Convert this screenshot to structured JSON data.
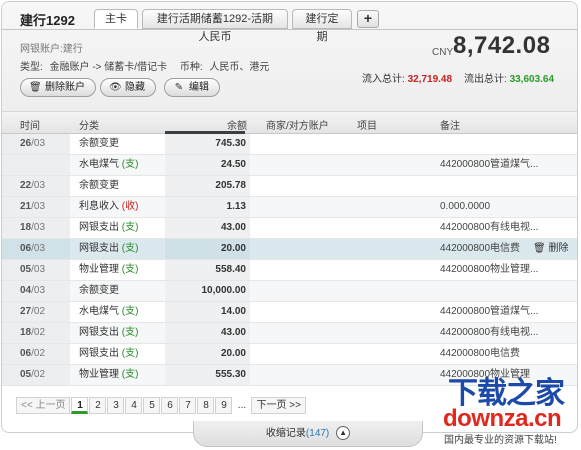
{
  "account": {
    "title": "建行1292",
    "tabs": [
      {
        "label": "主卡"
      },
      {
        "label": "建行活期储蓄1292-活期人民币"
      },
      {
        "label": "建行定期"
      }
    ],
    "add_tab_label": "+",
    "subtitle": "网银账户:建行",
    "type_label": "类型:",
    "type_value": "金融账户 -> 储蓄卡/借记卡",
    "currency_label": "币种:",
    "currency_value": "人民币、港元",
    "actions": {
      "delete": "删除账户",
      "hide": "隐藏",
      "edit": "编辑"
    },
    "balance_currency": "CNY",
    "balance": "8,742.08",
    "inflow_label": "流入总计:",
    "inflow": "32,719.48",
    "outflow_label": "流出总计:",
    "outflow": "33,603.64"
  },
  "colors": {
    "inflow": "#c62020",
    "outflow": "#2a9a2a",
    "selected_row": "#dbe9ef",
    "page_accent": "#2f9a2a"
  },
  "table": {
    "headers": {
      "time": "时间",
      "category": "分类",
      "amount": "余额",
      "merchant": "商家/对方账户",
      "project": "项目",
      "note": "备注"
    },
    "rows": [
      {
        "day": "26",
        "month": "/03",
        "cat": "余额变更",
        "tag": "",
        "tag_type": "",
        "amount": "745.30",
        "note": ""
      },
      {
        "day": "",
        "month": "",
        "cat": "水电煤气",
        "tag": "(支)",
        "tag_type": "out",
        "amount": "24.50",
        "note": "442000800管道煤气..."
      },
      {
        "day": "22",
        "month": "/03",
        "cat": "余额变更",
        "tag": "",
        "tag_type": "",
        "amount": "205.78",
        "note": ""
      },
      {
        "day": "21",
        "month": "/03",
        "cat": "利息收入",
        "tag": "(收)",
        "tag_type": "in",
        "amount": "1.13",
        "note": "0.000.0000"
      },
      {
        "day": "18",
        "month": "/03",
        "cat": "网银支出",
        "tag": "(支)",
        "tag_type": "out",
        "amount": "43.00",
        "note": "442000800有线电视..."
      },
      {
        "day": "06",
        "month": "/03",
        "cat": "网银支出",
        "tag": "(支)",
        "tag_type": "out",
        "amount": "20.00",
        "note": "442000800电信费",
        "selected": true,
        "delete": "删除"
      },
      {
        "day": "05",
        "month": "/03",
        "cat": "物业管理",
        "tag": "(支)",
        "tag_type": "out",
        "amount": "558.40",
        "note": "442000800物业管理..."
      },
      {
        "day": "04",
        "month": "/03",
        "cat": "余额变更",
        "tag": "",
        "tag_type": "",
        "amount": "10,000.00",
        "note": ""
      },
      {
        "day": "27",
        "month": "/02",
        "cat": "水电煤气",
        "tag": "(支)",
        "tag_type": "out",
        "amount": "14.00",
        "note": "442000800管道煤气..."
      },
      {
        "day": "18",
        "month": "/02",
        "cat": "网银支出",
        "tag": "(支)",
        "tag_type": "out",
        "amount": "43.00",
        "note": "442000800有线电视..."
      },
      {
        "day": "06",
        "month": "/02",
        "cat": "网银支出",
        "tag": "(支)",
        "tag_type": "out",
        "amount": "20.00",
        "note": "442000800电信费"
      },
      {
        "day": "05",
        "month": "/02",
        "cat": "物业管理",
        "tag": "(支)",
        "tag_type": "out",
        "amount": "555.30",
        "note": "442000800物业管理"
      }
    ]
  },
  "pagination": {
    "prev": "<< 上一页",
    "pages": [
      "1",
      "2",
      "3",
      "4",
      "5",
      "6",
      "7",
      "8",
      "9"
    ],
    "current": "1",
    "dots": "...",
    "next": "下一页 >>"
  },
  "footer": {
    "label": "收缩记录",
    "count": "(147)",
    "toggle": "▲"
  },
  "watermark": {
    "cn": "下载之家",
    "en": "downza.cn",
    "sub": "国内最专业的资源下载站!"
  }
}
